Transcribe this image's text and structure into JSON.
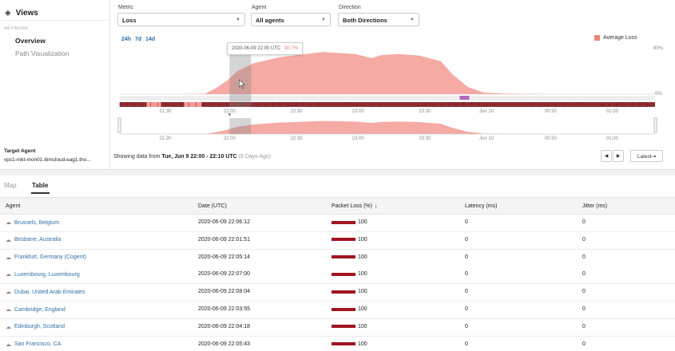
{
  "sidebar": {
    "title": "Views",
    "section": "NETWORK",
    "items": [
      {
        "label": "Overview",
        "active": true
      },
      {
        "label": "Path Visualization",
        "active": false
      }
    ],
    "target_agent_label": "Target Agent",
    "target_agent_value": "vps1-mkt-mon01.ibmcloud.eag1.tho..."
  },
  "controls": {
    "metric": {
      "label": "Metric",
      "value": "Loss"
    },
    "agent": {
      "label": "Agent",
      "value": "All agents"
    },
    "direction": {
      "label": "Direction",
      "value": "Both Directions"
    }
  },
  "time_ranges": [
    "24h",
    "7d",
    "14d"
  ],
  "legend": {
    "label": "Average Loss",
    "color": "#e8867a"
  },
  "tooltip": {
    "time": "2020-06-09 22:00 UTC",
    "value": "30.7%"
  },
  "chart_data": {
    "type": "area",
    "series": [
      {
        "name": "Average Loss",
        "color": "#f39b93"
      }
    ],
    "x_tick_labels": [
      "21:30",
      "22:00",
      "22:30",
      "23:00",
      "23:30",
      "Jun 10",
      "00:30",
      "01:00"
    ],
    "y_tick_labels": [
      "90%",
      "0%"
    ],
    "ylim": [
      0,
      90
    ],
    "x": [
      0,
      0.06,
      0.12,
      0.16,
      0.18,
      0.2,
      0.22,
      0.25,
      0.3,
      0.38,
      0.44,
      0.47,
      0.49,
      0.52,
      0.56,
      0.6,
      0.62,
      0.65,
      0.68,
      0.72,
      0.8,
      0.9,
      1.0
    ],
    "y": [
      0,
      0,
      0,
      1,
      12,
      26,
      45,
      60,
      72,
      82,
      78,
      70,
      76,
      78,
      75,
      64,
      40,
      14,
      3,
      1,
      0,
      0,
      0
    ]
  },
  "status": {
    "prefix": "Showing data from ",
    "range": "Tue, Jun 9 22:00 - 22:10 UTC",
    "ago": "(6 Days Ago)"
  },
  "nav_buttons": {
    "prev": "◀",
    "next": "▶",
    "latest": "Latest⇥"
  },
  "tabs": [
    {
      "label": "Map"
    },
    {
      "label": "Table"
    }
  ],
  "table": {
    "headers": [
      "Agent",
      "Date (UTC)",
      "Packet Loss (%)",
      "Latency (ms)",
      "Jitter (ms)"
    ],
    "loss_bar_color": "#a01420",
    "rows": [
      {
        "agent": "Brussels, Belgium",
        "date": "2020-06-09 22:06:12",
        "loss": "100",
        "latency": "0",
        "jitter": "0"
      },
      {
        "agent": "Brisbane, Australia",
        "date": "2020-06-09 22:01:51",
        "loss": "100",
        "latency": "0",
        "jitter": "0"
      },
      {
        "agent": "Frankfurt, Germany (Cogent)",
        "date": "2020-06-09 22:05:14",
        "loss": "100",
        "latency": "0",
        "jitter": "0"
      },
      {
        "agent": "Luxembourg, Luxembourg",
        "date": "2020-06-09 22:07:00",
        "loss": "100",
        "latency": "0",
        "jitter": "0"
      },
      {
        "agent": "Dubai, United Arab Emirates",
        "date": "2020-06-09 22:08:04",
        "loss": "100",
        "latency": "0",
        "jitter": "0"
      },
      {
        "agent": "Cambridge, England",
        "date": "2020-06-09 22:03:55",
        "loss": "100",
        "latency": "0",
        "jitter": "0"
      },
      {
        "agent": "Edinburgh, Scotland",
        "date": "2020-06-09 22:04:18",
        "loss": "100",
        "latency": "0",
        "jitter": "0"
      },
      {
        "agent": "San Francisco, CA",
        "date": "2020-06-09 22:05:43",
        "loss": "100",
        "latency": "0",
        "jitter": "0"
      }
    ]
  }
}
